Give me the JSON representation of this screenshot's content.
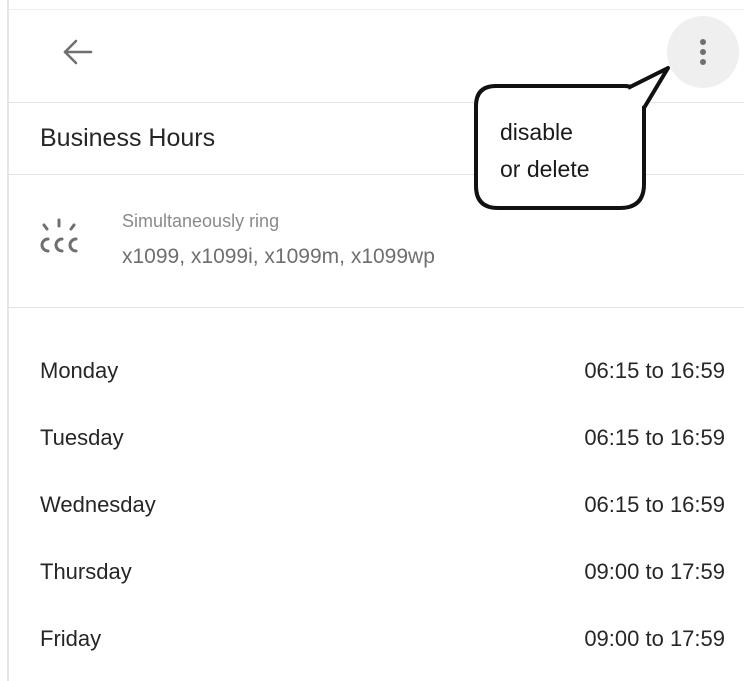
{
  "header": {
    "back_icon": "arrow-back-icon",
    "more_icon": "more-vertical-icon"
  },
  "section": {
    "title": "Business Hours"
  },
  "ring": {
    "icon": "simultaneous-ring-icon",
    "label": "Simultaneously ring",
    "targets": "x1099, x1099i, x1099m, x1099wp"
  },
  "hours": [
    {
      "day": "Monday",
      "hours": "06:15 to 16:59"
    },
    {
      "day": "Tuesday",
      "hours": "06:15 to 16:59"
    },
    {
      "day": "Wednesday",
      "hours": "06:15 to 16:59"
    },
    {
      "day": "Thursday",
      "hours": "09:00 to 17:59"
    },
    {
      "day": "Friday",
      "hours": "09:00 to 17:59"
    }
  ],
  "annotation": {
    "line1": "disable",
    "line2": "or delete"
  },
  "colors": {
    "text_primary": "#262626",
    "text_secondary": "#8a8a8a",
    "icon": "#6f6f6f",
    "more_button_bg": "#efefef",
    "divider": "#e3e3e3"
  }
}
